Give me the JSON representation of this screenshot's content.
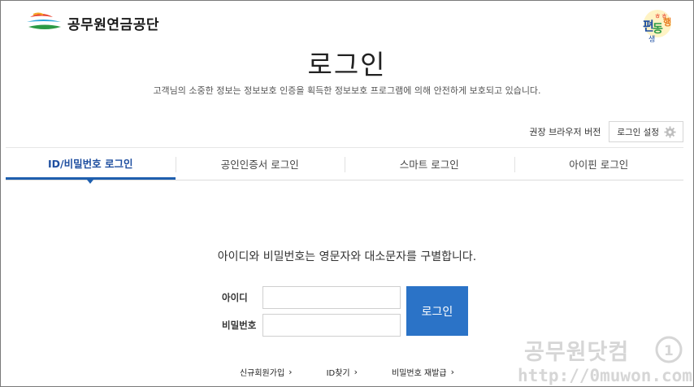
{
  "header": {
    "logo_text": "공무원연금공단"
  },
  "page": {
    "title": "로그인",
    "subtitle": "고객님의 소중한 정보는 정보보호 인증을 획득한 정보보호 프로그램에 의해 안전하게 보호되고 있습니다."
  },
  "util": {
    "browser_label": "권장 브라우저 버전",
    "settings_label": "로그인 설정"
  },
  "tabs": [
    {
      "label": "ID/비밀번호 로그인",
      "active": true
    },
    {
      "label": "공인인증서 로그인",
      "active": false
    },
    {
      "label": "스마트 로그인",
      "active": false
    },
    {
      "label": "아이핀 로그인",
      "active": false
    }
  ],
  "notice": "아이디와 비밀번호는 영문자와 대소문자를 구별합니다.",
  "form": {
    "id_label": "아이디",
    "id_value": "",
    "pw_label": "비밀번호",
    "pw_value": "",
    "login_button": "로그인"
  },
  "links": [
    {
      "label": "신규회원가입"
    },
    {
      "label": "ID찾기"
    },
    {
      "label": "비밀번호 재발급"
    }
  ],
  "watermark": {
    "line1": "공무원닷컴",
    "line2": "http://0muwon.com"
  },
  "colors": {
    "accent": "#2b73c7",
    "active_tab": "#1f4fa0"
  }
}
